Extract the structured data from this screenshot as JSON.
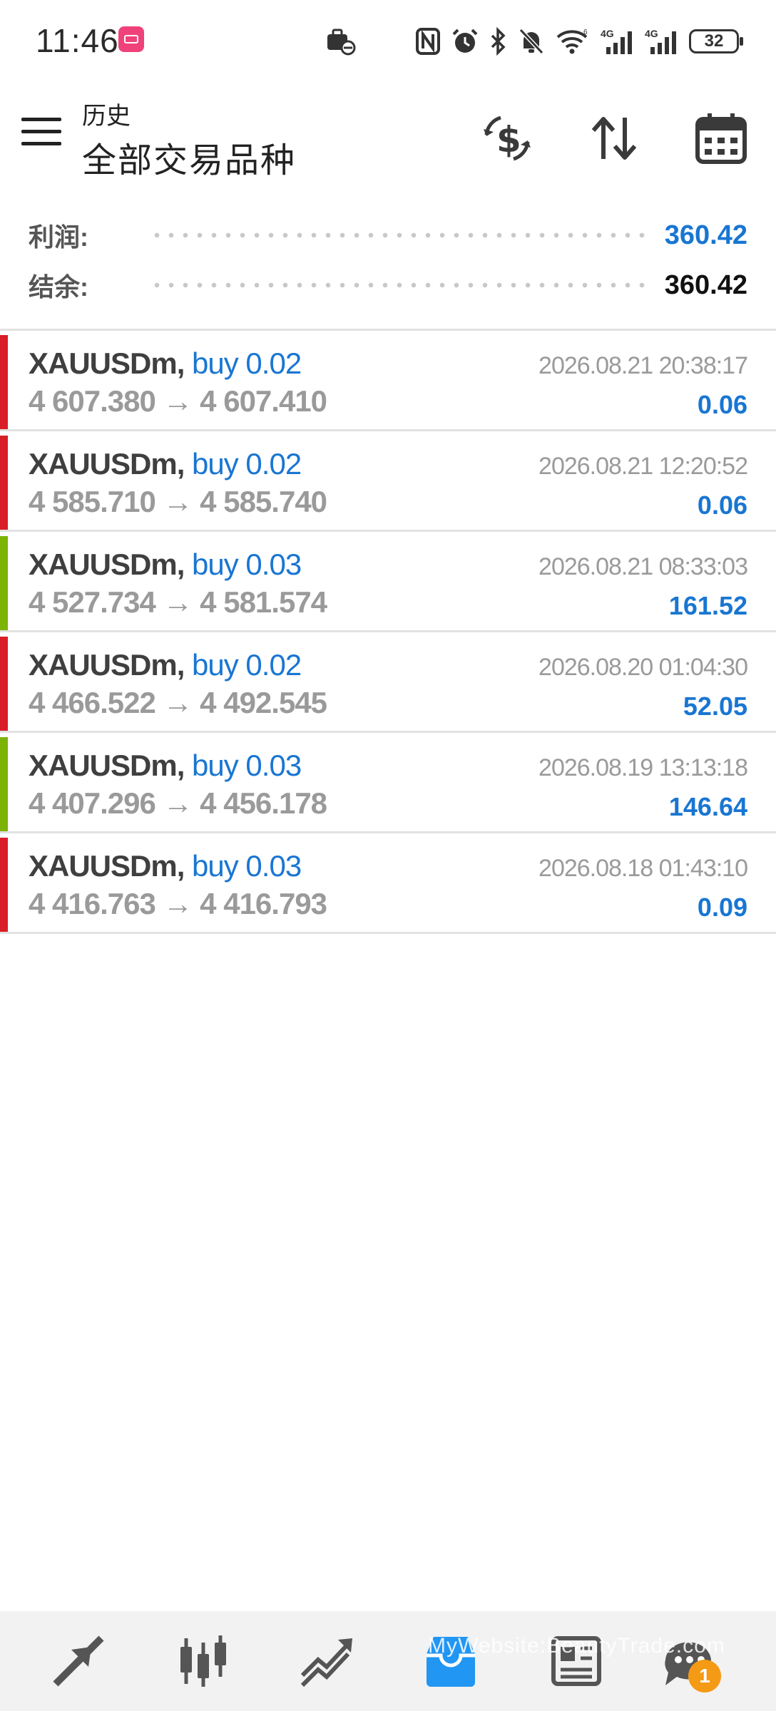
{
  "status_bar": {
    "time": "11:46",
    "battery": "32"
  },
  "header": {
    "subtitle": "历史",
    "title": "全部交易品种"
  },
  "toolbar": {
    "icons": [
      "currency-exchange-icon",
      "sort-icon",
      "calendar-icon"
    ]
  },
  "summary": {
    "profit_label": "利润:",
    "profit_value": "360.42",
    "balance_label": "结余:",
    "balance_value": "360.42"
  },
  "trades": [
    {
      "symbol": "XAUUSDm,",
      "side": "buy 0.02",
      "prices": "4 607.380 → 4 607.410",
      "time": "2026.08.21 20:38:17",
      "profit": "0.06",
      "bar_color": "#d81e28"
    },
    {
      "symbol": "XAUUSDm,",
      "side": "buy 0.02",
      "prices": "4 585.710 → 4 585.740",
      "time": "2026.08.21 12:20:52",
      "profit": "0.06",
      "bar_color": "#d81e28"
    },
    {
      "symbol": "XAUUSDm,",
      "side": "buy 0.03",
      "prices": "4 527.734 → 4 581.574",
      "time": "2026.08.21 08:33:03",
      "profit": "161.52",
      "bar_color": "#7cb305"
    },
    {
      "symbol": "XAUUSDm,",
      "side": "buy 0.02",
      "prices": "4 466.522 → 4 492.545",
      "time": "2026.08.20 01:04:30",
      "profit": "52.05",
      "bar_color": "#d81e28"
    },
    {
      "symbol": "XAUUSDm,",
      "side": "buy 0.03",
      "prices": "4 407.296 → 4 456.178",
      "time": "2026.08.19 13:13:18",
      "profit": "146.64",
      "bar_color": "#7cb305"
    },
    {
      "symbol": "XAUUSDm,",
      "side": "buy 0.03",
      "prices": "4 416.763 → 4 416.793",
      "time": "2026.08.18 01:43:10",
      "profit": "0.09",
      "bar_color": "#d81e28"
    }
  ],
  "bottom_nav": {
    "watermark": "MyWebsite:BeautyTrade.com",
    "badge_count": "1",
    "active_color": "#2196f3"
  },
  "colors": {
    "accent_blue": "#1976d2",
    "loss_red": "#d81e28",
    "gain_green": "#7cb305"
  }
}
